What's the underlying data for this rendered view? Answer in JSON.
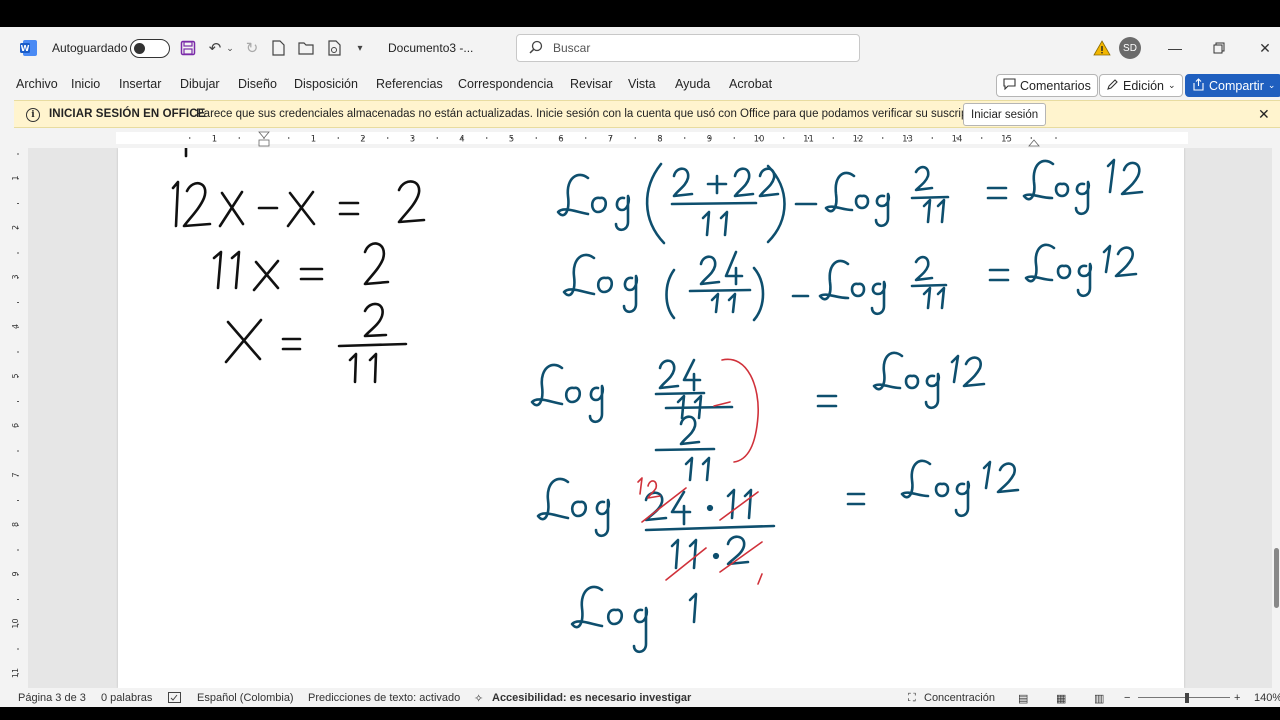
{
  "titlebar": {
    "autosave_label": "Autoguardado",
    "doc_title": "Documento3  -...",
    "search_placeholder": "Buscar",
    "avatar_initials": "SD"
  },
  "menu": {
    "items": [
      "Archivo",
      "Inicio",
      "Insertar",
      "Dibujar",
      "Diseño",
      "Disposición",
      "Referencias",
      "Correspondencia",
      "Revisar",
      "Vista",
      "Ayuda",
      "Acrobat"
    ],
    "comments_label": "Comentarios",
    "editing_label": "Edición",
    "share_label": "Compartir"
  },
  "infobar": {
    "title": "INICIAR SESIÓN EN OFFICE",
    "message": "Parece que sus credenciales almacenadas no están actualizadas. Inicie sesión con la cuenta que usó con Office para que podamos verificar su suscripción.",
    "button_label": "Iniciar sesión"
  },
  "ruler": {
    "labels": [
      "1",
      "1",
      "2",
      "3",
      "4",
      "5",
      "6",
      "7",
      "8",
      "9",
      "10",
      "11",
      "12",
      "13",
      "14",
      "15"
    ],
    "vlabels": [
      "1",
      "2",
      "3",
      "4",
      "5",
      "6",
      "7",
      "8",
      "9",
      "10",
      "11"
    ]
  },
  "handwriting": {
    "left": [
      "12x − x = 2",
      "11x = 2",
      "x = 2/11"
    ],
    "right": [
      "Log((2+22)/11) − Log(2/11) = Log 12",
      "Log(24/11) − Log(2/11) = Log 12",
      "Log((24/11)/(2/11)) = Log 12",
      "Log((24·11)/(11·2)) = Log 12",
      "Log 1"
    ],
    "colors": {
      "left_ink": "#111111",
      "right_ink": "#0e4f6e",
      "correction_ink": "#d0313a"
    }
  },
  "statusbar": {
    "page": "Página 3 de 3",
    "words": "0 palabras",
    "language": "Español (Colombia)",
    "predictions": "Predicciones de texto: activado",
    "accessibility": "Accesibilidad: es necesario investigar",
    "focus": "Concentración",
    "zoom": "140%"
  }
}
